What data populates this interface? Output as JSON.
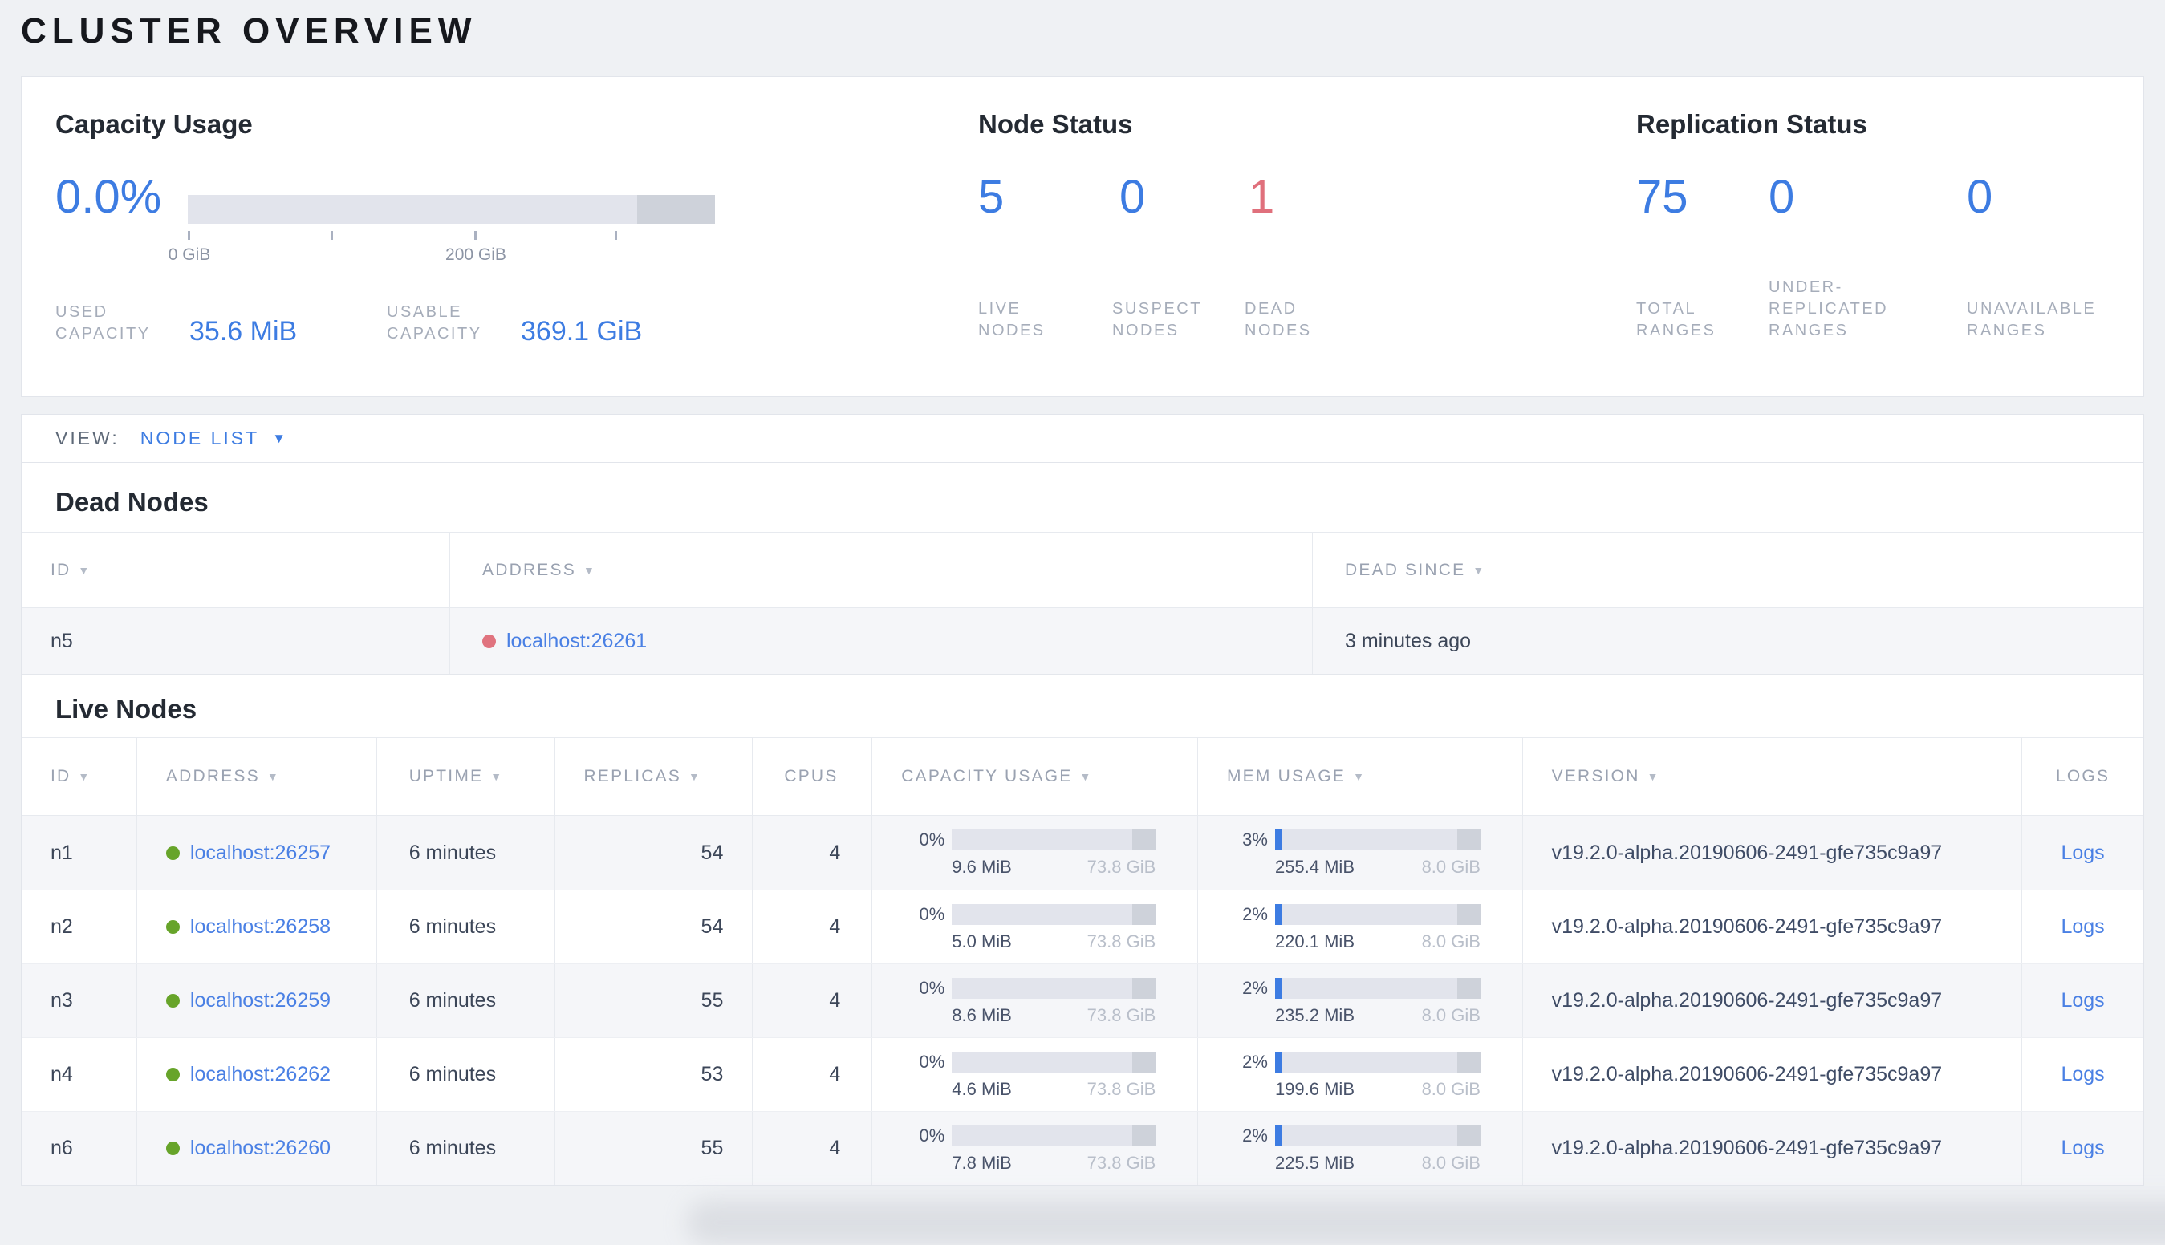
{
  "page": {
    "title": "CLUSTER OVERVIEW"
  },
  "colors": {
    "accent_blue": "#3d7ce2",
    "link_blue": "#4a80e4",
    "danger_pink": "#e0707c",
    "live_green": "#67a42a",
    "bar_track": "#e2e4ec",
    "bar_reserved": "#ced2da",
    "page_bg": "#eff1f4"
  },
  "capacity_usage": {
    "heading": "Capacity Usage",
    "percent_used": "0.0%",
    "axis_tick_labels": {
      "start": "0 GiB",
      "mid": "200 GiB"
    },
    "used": {
      "label": "USED CAPACITY",
      "value": "35.6 MiB"
    },
    "usable": {
      "label": "USABLE CAPACITY",
      "value": "369.1 GiB"
    }
  },
  "node_status": {
    "heading": "Node Status",
    "live": {
      "value": "5",
      "label": "LIVE NODES"
    },
    "suspect": {
      "value": "0",
      "label": "SUSPECT NODES"
    },
    "dead": {
      "value": "1",
      "label": "DEAD NODES"
    }
  },
  "replication_status": {
    "heading": "Replication Status",
    "total": {
      "value": "75",
      "label": "TOTAL RANGES"
    },
    "under_replicated": {
      "value": "0",
      "label": "UNDER-REPLICATED RANGES"
    },
    "unavailable": {
      "value": "0",
      "label": "UNAVAILABLE RANGES"
    }
  },
  "view_bar": {
    "label": "VIEW:",
    "selected": "NODE LIST"
  },
  "dead_nodes": {
    "heading": "Dead Nodes",
    "columns": {
      "id": "ID",
      "address": "ADDRESS",
      "dead_since": "DEAD SINCE"
    },
    "rows": [
      {
        "id": "n5",
        "address": "localhost:26261",
        "dead_since": "3 minutes ago"
      }
    ]
  },
  "live_nodes": {
    "heading": "Live Nodes",
    "columns": {
      "id": "ID",
      "address": "ADDRESS",
      "uptime": "UPTIME",
      "replicas": "REPLICAS",
      "cpus": "CPUS",
      "capacity": "CAPACITY USAGE",
      "mem": "MEM USAGE",
      "version": "VERSION",
      "logs": "LOGS"
    },
    "rows": [
      {
        "id": "n1",
        "address": "localhost:26257",
        "uptime": "6 minutes",
        "replicas": "54",
        "cpus": "4",
        "capacity": {
          "pct_label": "0%",
          "pct": 0,
          "used": "9.6 MiB",
          "total": "73.8 GiB"
        },
        "mem": {
          "pct_label": "3%",
          "pct": 3,
          "used": "255.4 MiB",
          "total": "8.0 GiB"
        },
        "version": "v19.2.0-alpha.20190606-2491-gfe735c9a97",
        "logs": "Logs"
      },
      {
        "id": "n2",
        "address": "localhost:26258",
        "uptime": "6 minutes",
        "replicas": "54",
        "cpus": "4",
        "capacity": {
          "pct_label": "0%",
          "pct": 0,
          "used": "5.0 MiB",
          "total": "73.8 GiB"
        },
        "mem": {
          "pct_label": "2%",
          "pct": 2,
          "used": "220.1 MiB",
          "total": "8.0 GiB"
        },
        "version": "v19.2.0-alpha.20190606-2491-gfe735c9a97",
        "logs": "Logs"
      },
      {
        "id": "n3",
        "address": "localhost:26259",
        "uptime": "6 minutes",
        "replicas": "55",
        "cpus": "4",
        "capacity": {
          "pct_label": "0%",
          "pct": 0,
          "used": "8.6 MiB",
          "total": "73.8 GiB"
        },
        "mem": {
          "pct_label": "2%",
          "pct": 2,
          "used": "235.2 MiB",
          "total": "8.0 GiB"
        },
        "version": "v19.2.0-alpha.20190606-2491-gfe735c9a97",
        "logs": "Logs"
      },
      {
        "id": "n4",
        "address": "localhost:26262",
        "uptime": "6 minutes",
        "replicas": "53",
        "cpus": "4",
        "capacity": {
          "pct_label": "0%",
          "pct": 0,
          "used": "4.6 MiB",
          "total": "73.8 GiB"
        },
        "mem": {
          "pct_label": "2%",
          "pct": 2,
          "used": "199.6 MiB",
          "total": "8.0 GiB"
        },
        "version": "v19.2.0-alpha.20190606-2491-gfe735c9a97",
        "logs": "Logs"
      },
      {
        "id": "n6",
        "address": "localhost:26260",
        "uptime": "6 minutes",
        "replicas": "55",
        "cpus": "4",
        "capacity": {
          "pct_label": "0%",
          "pct": 0,
          "used": "7.8 MiB",
          "total": "73.8 GiB"
        },
        "mem": {
          "pct_label": "2%",
          "pct": 2,
          "used": "225.5 MiB",
          "total": "8.0 GiB"
        },
        "version": "v19.2.0-alpha.20190606-2491-gfe735c9a97",
        "logs": "Logs"
      }
    ]
  }
}
